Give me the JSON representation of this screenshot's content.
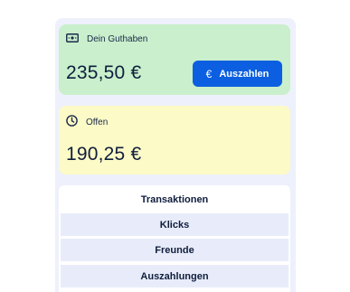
{
  "balance_card": {
    "label": "Dein Guthaben",
    "icon": "banknote-icon",
    "amount": "235,50 €",
    "payout_button": {
      "icon_glyph": "€",
      "label": "Auszahlen"
    }
  },
  "open_card": {
    "label": "Offen",
    "icon": "clock-icon",
    "amount": "190,25 €"
  },
  "tabs": [
    {
      "label": "Transaktionen",
      "active": true
    },
    {
      "label": "Klicks",
      "active": false
    },
    {
      "label": "Freunde",
      "active": false
    },
    {
      "label": "Auszahlungen",
      "active": false
    }
  ],
  "colors": {
    "balance_bg": "#c9efcc",
    "open_bg": "#fcfac6",
    "accent": "#0b5fe0",
    "panel_bg": "#eef1fb"
  }
}
